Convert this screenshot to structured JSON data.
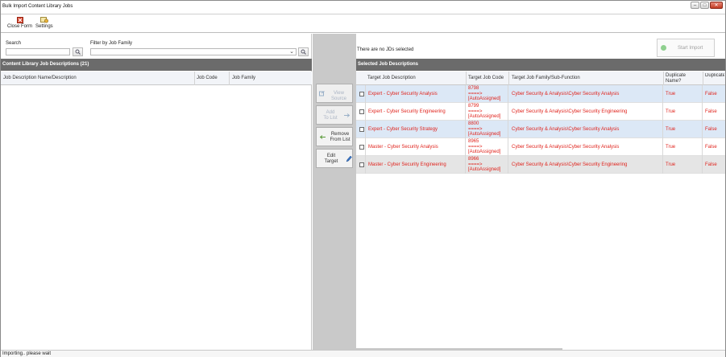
{
  "window": {
    "title": "Bulk Import Content Library Jobs"
  },
  "toolbar": {
    "close_form": "Close Form",
    "settings": "Settings"
  },
  "filters": {
    "search_label": "Search",
    "search_value": "",
    "family_label": "Filter by Job Family",
    "family_value": ""
  },
  "library": {
    "header": "Content Library Job Descriptions (21)",
    "columns": [
      "Job Description Name/Description",
      "Job Code",
      "Job Family"
    ]
  },
  "actions": {
    "view_source": "View Source",
    "add_to_list_1": "Add",
    "add_to_list_2": "To List",
    "remove_1": "Remove",
    "remove_2": "From List",
    "edit_1": "Edit",
    "edit_2": "Target"
  },
  "selected": {
    "status": "There are no JDs selected",
    "start_import": "Start Import",
    "header": "Selected Job Descriptions",
    "columns": [
      "Target Job Description",
      "Target Job Code",
      "Target Job Family/Sub-Function",
      "Duplicate Name?",
      "Duplicate Code?"
    ],
    "rows": [
      {
        "desc": "Expert - Cyber Security Analysis",
        "code": "8798",
        "arrow": "====>",
        "auto": "[AutoAssigned]",
        "family": "Cyber Security & Analysis\\Cyber Security Analysis",
        "dup_name": "True",
        "dup_code": "False"
      },
      {
        "desc": "Expert - Cyber Security Engineering",
        "code": "8799",
        "arrow": "====>",
        "auto": "[AutoAssigned]",
        "family": "Cyber Security & Analysis\\Cyber Security Engineering",
        "dup_name": "True",
        "dup_code": "False"
      },
      {
        "desc": "Expert - Cyber Security Strategy",
        "code": "8800",
        "arrow": "====>",
        "auto": "[AutoAssigned]",
        "family": "Cyber Security & Analysis\\Cyber Security Analysis",
        "dup_name": "True",
        "dup_code": "False"
      },
      {
        "desc": "Master - Cyber Security Analysis",
        "code": "8965",
        "arrow": "====>",
        "auto": "[AutoAssigned]",
        "family": "Cyber Security & Analysis\\Cyber Security Analysis",
        "dup_name": "True",
        "dup_code": "False"
      },
      {
        "desc": "Master - Cyber Security Engineering",
        "code": "8966",
        "arrow": "====>",
        "auto": "[AutoAssigned]",
        "family": "Cyber Security & Analysis\\Cyber Security Engineering",
        "dup_name": "True",
        "dup_code": "False"
      }
    ]
  },
  "status_bar": {
    "text": "Importing.. please wait"
  },
  "icons": {
    "close_form": "close-form-icon",
    "settings": "settings-icon",
    "search": "magnifier-icon",
    "view_source": "view-source-icon",
    "add": "arrow-right-icon",
    "remove": "arrow-left-icon",
    "edit": "pencil-icon",
    "start": "start-icon"
  },
  "colors": {
    "header_bg": "#6b6b6b",
    "row_text": "#e0241d",
    "row_alt": "#dce8f6",
    "action_bg": "#c9c9c9"
  }
}
